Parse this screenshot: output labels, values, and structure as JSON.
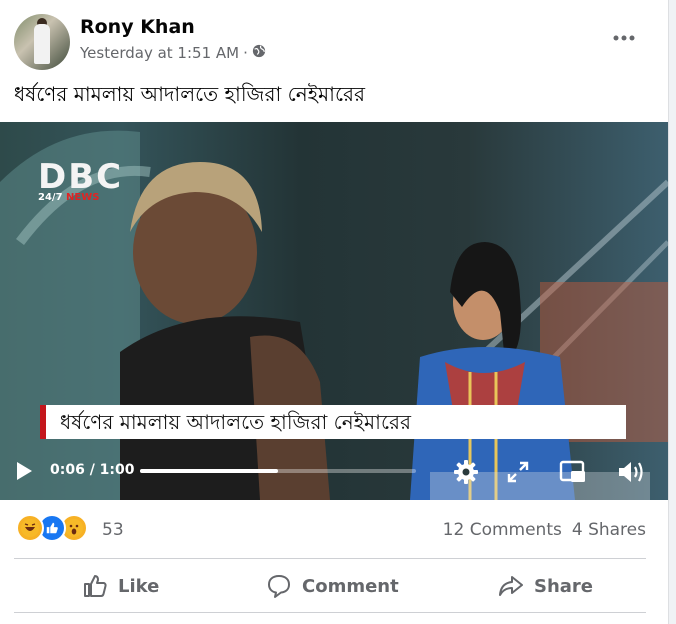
{
  "post": {
    "author": "Rony Khan",
    "timestamp": "Yesterday at 1:51 AM",
    "separator": "·",
    "text": "ধর্ষণের মামলায় আদালতে হাজিরা নেইমারের"
  },
  "video": {
    "logo_text": "DBC",
    "logo_sub_a": "24/7",
    "logo_sub_b": "NEWS",
    "headline": "ধর্ষণের মামলায় আদালতে হাজিরা নেইমারের",
    "time": "0:06 / 1:00",
    "progress": 0.5
  },
  "engagement": {
    "reaction_count": "53",
    "comments": "12 Comments",
    "shares": "4 Shares"
  },
  "actions": {
    "like": "Like",
    "comment": "Comment",
    "share": "Share"
  },
  "colors": {
    "accent": "#1877f2",
    "text": "#050505",
    "secondary": "#65676b",
    "lower_third_bar": "#c4161c"
  },
  "icons": [
    "globe-icon",
    "more-icon",
    "play-icon",
    "settings-icon",
    "fullscreen-icon",
    "pip-icon",
    "volume-icon",
    "haha-reaction-icon",
    "like-reaction-icon",
    "wow-reaction-icon",
    "like-icon",
    "comment-icon",
    "share-icon"
  ]
}
